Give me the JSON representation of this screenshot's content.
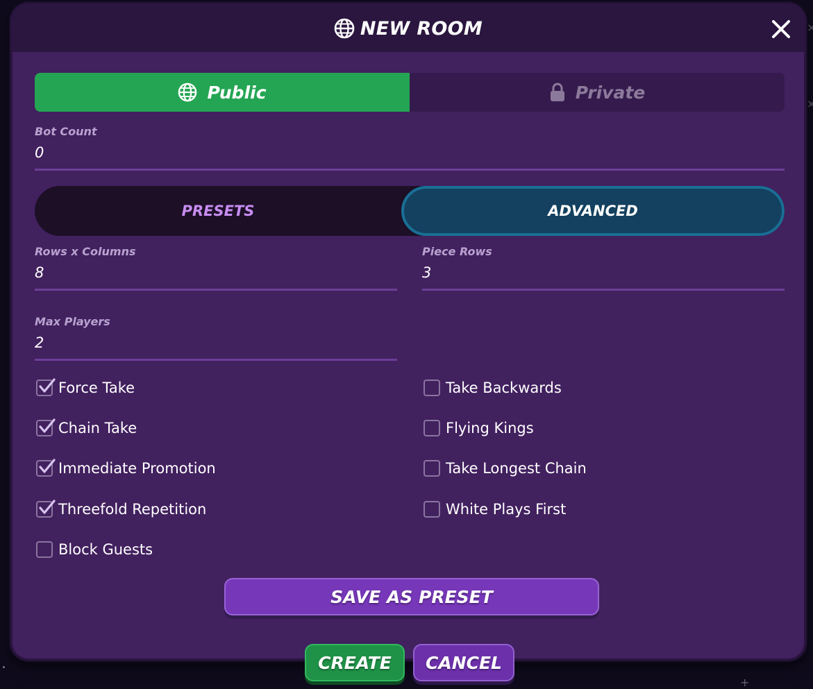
{
  "modal": {
    "title": "NEW ROOM",
    "title_icon": "globe-icon",
    "close_icon": "close-icon"
  },
  "visibility": {
    "selected": "Public",
    "options": [
      {
        "label": "Public",
        "icon": "globe-icon",
        "active": true
      },
      {
        "label": "Private",
        "icon": "lock-icon",
        "active": false
      }
    ]
  },
  "fields": {
    "bot_count": {
      "label": "Bot Count",
      "value": "0"
    },
    "rows_columns": {
      "label": "Rows x Columns",
      "value": "8"
    },
    "piece_rows": {
      "label": "Piece Rows",
      "value": "3"
    },
    "max_players": {
      "label": "Max Players",
      "value": "2"
    }
  },
  "mode_tabs": {
    "presets": "PRESETS",
    "advanced": "ADVANCED",
    "selected": "ADVANCED"
  },
  "options": {
    "left": [
      {
        "label": "Force Take",
        "checked": true
      },
      {
        "label": "Chain Take",
        "checked": true
      },
      {
        "label": "Immediate Promotion",
        "checked": true
      },
      {
        "label": "Threefold Repetition",
        "checked": true
      },
      {
        "label": "Block Guests",
        "checked": false
      }
    ],
    "right": [
      {
        "label": "Take Backwards",
        "checked": false
      },
      {
        "label": "Flying Kings",
        "checked": false
      },
      {
        "label": "Take Longest Chain",
        "checked": false
      },
      {
        "label": "White Plays First",
        "checked": false
      }
    ]
  },
  "buttons": {
    "save_preset": "SAVE AS PRESET",
    "create": "CREATE",
    "cancel": "CANCEL"
  },
  "colors": {
    "modal_bg": "#42215f",
    "header_bg": "#2a163f",
    "public_active": "#24a553",
    "advanced_active": "#13415f",
    "save_button": "#7637b9",
    "create_button": "#1f9247",
    "cancel_button": "#6c30ab"
  }
}
